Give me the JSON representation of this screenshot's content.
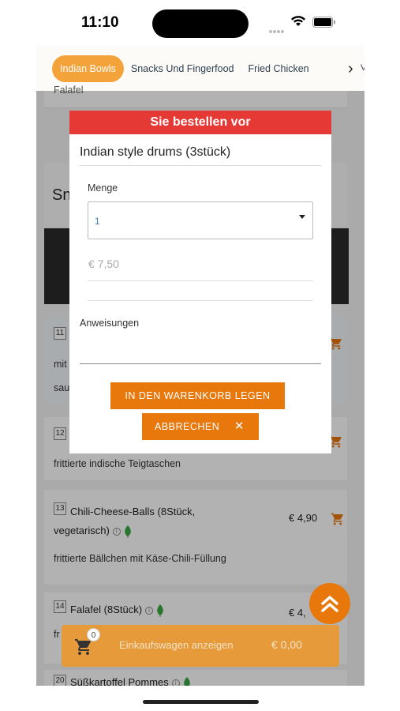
{
  "status_bar": {
    "time": "11:10"
  },
  "categories": {
    "items": [
      "Indian Bowls",
      "Snacks Und Fingerfood",
      "Fried Chicken"
    ],
    "active_index": 0,
    "next_partial": "V"
  },
  "background": {
    "top_partial_text": "Falafel",
    "section_partial": "Sn",
    "dishes": [
      {
        "num": "11",
        "line1_partial": "mit",
        "line2_partial": "sau"
      },
      {
        "num": "12",
        "desc": "frittierte indische Teigtaschen"
      },
      {
        "num": "13",
        "name": "Chili-Cheese-Balls (8Stück,",
        "name2": "vegetarisch)",
        "price": "€ 4,90",
        "desc": "frittierte Bällchen mit Käse-Chili-Füllung"
      },
      {
        "num": "14",
        "name": "Falafel (8Stück)",
        "price_partial": "€ 4,",
        "desc_partial": "fr"
      },
      {
        "num": "20",
        "name": "Süßkartoffel Pommes"
      }
    ]
  },
  "modal": {
    "header": "Sie bestellen vor",
    "item_title": "Indian style drums (3stück)",
    "quantity_label": "Menge",
    "quantity_value": "1",
    "price": "€ 7,50",
    "instructions_label": "Anweisungen",
    "add_to_cart_label": "IN DEN WARENKORB LEGEN",
    "cancel_label": "ABBRECHEN",
    "cancel_icon": "✕"
  },
  "cart_bar": {
    "count": "0",
    "label": "Einkaufswagen anzeigen",
    "total": "€ 0,00"
  },
  "colors": {
    "accent_orange": "#e8770c",
    "modal_header_red": "#e53935",
    "category_active": "#f4a23a"
  },
  "icons": [
    "wifi-icon",
    "battery-icon",
    "chevron-right-icon",
    "cart-icon",
    "info-icon",
    "leaf-icon",
    "double-chevron-up-icon",
    "close-icon",
    "caret-down-icon"
  ]
}
